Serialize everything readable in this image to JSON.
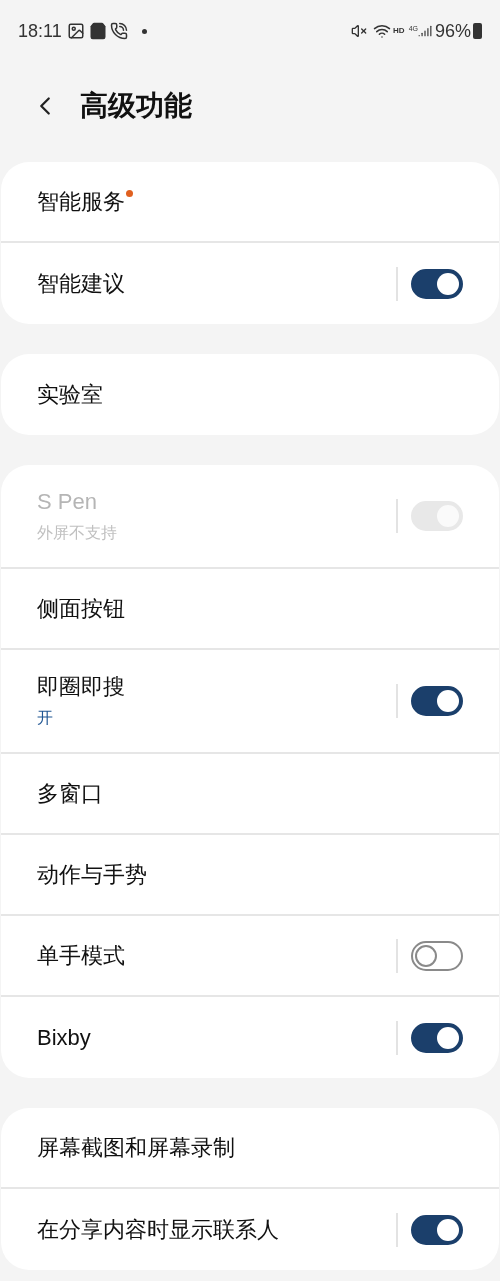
{
  "status_bar": {
    "time": "18:11",
    "hd": "HD",
    "network": "4G",
    "battery": "96%"
  },
  "header": {
    "title": "高级功能"
  },
  "groups": [
    {
      "rows": [
        {
          "kind": "link",
          "title": "智能服务",
          "dot": true
        },
        {
          "kind": "toggle",
          "title": "智能建议",
          "on": true,
          "disabled": false
        }
      ]
    },
    {
      "rows": [
        {
          "kind": "link",
          "title": "实验室"
        }
      ]
    },
    {
      "rows": [
        {
          "kind": "toggle",
          "title": "S Pen",
          "subtitle": "外屏不支持",
          "on": true,
          "disabled": true
        },
        {
          "kind": "link",
          "title": "侧面按钮"
        },
        {
          "kind": "toggle",
          "title": "即圈即搜",
          "subtitle": "开",
          "on": true,
          "disabled": false
        },
        {
          "kind": "link",
          "title": "多窗口"
        },
        {
          "kind": "link",
          "title": "动作与手势"
        },
        {
          "kind": "toggle",
          "title": "单手模式",
          "on": false,
          "disabled": false
        },
        {
          "kind": "toggle",
          "title": "Bixby",
          "on": true,
          "disabled": false
        }
      ]
    },
    {
      "rows": [
        {
          "kind": "link",
          "title": "屏幕截图和屏幕录制"
        },
        {
          "kind": "toggle",
          "title": "在分享内容时显示联系人",
          "on": true,
          "disabled": false
        }
      ]
    }
  ]
}
